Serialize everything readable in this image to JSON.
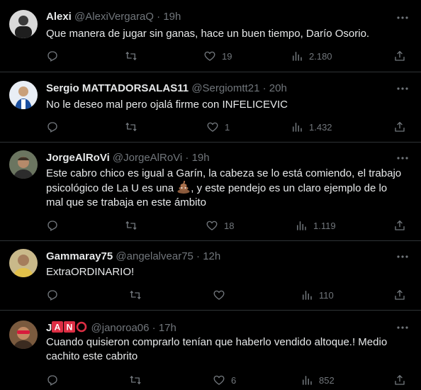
{
  "tweets": [
    {
      "name": "Alexi",
      "handle": "@AlexiVergaraQ",
      "separator": "·",
      "time": "19h",
      "text": "Que manera de jugar sin ganas, hace un buen tiempo, Darío Osorio.",
      "likes": "19",
      "views": "2.180",
      "retweets": "",
      "replies": ""
    },
    {
      "name": "Sergio MATTADORSALAS11",
      "handle": "@Sergiomtt21",
      "separator": "·",
      "time": "20h",
      "text": "No le deseo mal pero ojalá firme con INFELICEVIC",
      "likes": "1",
      "views": "1.432",
      "retweets": "",
      "replies": ""
    },
    {
      "name": "JorgeAlRoVi",
      "handle": "@JorgeAlRoVi",
      "separator": "·",
      "time": "19h",
      "text_part1": "Este cabro chico es igual a Garín, la cabeza se lo está comiendo, el trabajo",
      "text_part2a": "psicológico de La U es una",
      "text_part2b": ", y este pendejo es un claro ejemplo de lo",
      "text_part3": "mal que se trabaja en este ámbito",
      "emoji": "pile-of-poo",
      "likes": "18",
      "views": "1.119",
      "retweets": "",
      "replies": ""
    },
    {
      "name": "Gammaray75",
      "handle": "@angelalvear75",
      "separator": "·",
      "time": "12h",
      "text": "ExtraORDINARIO!",
      "likes": "",
      "views": "110",
      "retweets": "",
      "replies": ""
    },
    {
      "name_prefix": "J",
      "name_emoji_1": "A",
      "name_emoji_2": "N",
      "handle": "@janoroa06",
      "separator": "·",
      "time": "17h",
      "text_line1": "Cuando quisieron comprarlo tenían que haberlo vendido altoque.! Medio",
      "text_line2": "cachito este cabrito",
      "likes": "6",
      "views": "852",
      "retweets": "",
      "replies": ""
    }
  ],
  "icons": {
    "reply": "reply-icon",
    "retweet": "retweet-icon",
    "like": "heart-icon",
    "views": "views-icon",
    "share": "share-icon",
    "more": "more-icon"
  },
  "colors": {
    "background": "#000000",
    "text": "#e7e9ea",
    "muted": "#71767b",
    "divider": "#2f3336",
    "emoji_red": "#dd2e44"
  }
}
